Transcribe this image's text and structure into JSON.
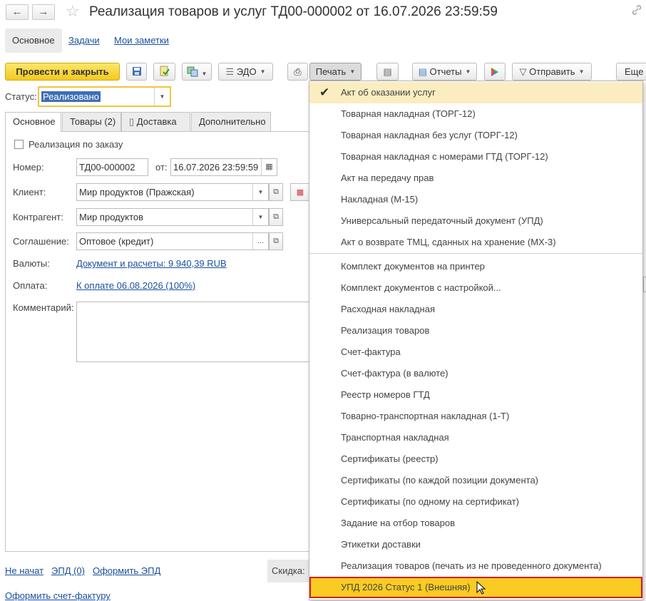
{
  "header": {
    "title": "Реализация товаров и услуг ТД00-000002 от 16.07.2026 23:59:59",
    "back_icon": "arrow-left",
    "forward_icon": "arrow-right",
    "star_icon": "star-outline",
    "link_icon": "link"
  },
  "top_tabs": [
    "Основное",
    "Задачи",
    "Мои заметки"
  ],
  "toolbar": {
    "post_close": "Провести и закрыть",
    "edo": "ЭДО",
    "print": "Печать",
    "reports": "Отчеты",
    "send": "Отправить",
    "more": "Еще"
  },
  "status": {
    "label": "Статус:",
    "value": "Реализовано"
  },
  "form_tabs": [
    "Основное",
    "Товары (2)",
    "Доставка",
    "Дополнительно"
  ],
  "form": {
    "by_order_label": "Реализация по заказу",
    "number_label": "Номер:",
    "number_value": "ТД00-000002",
    "date_label": "от:",
    "date_value": "16.07.2026 23:59:59",
    "client_label": "Клиент:",
    "client_value": "Мир продуктов (Пражская)",
    "counterparty_label": "Контрагент:",
    "counterparty_value": "Мир продуктов",
    "agreement_label": "Соглашение:",
    "agreement_value": "Оптовое (кредит)",
    "currency_label": "Валюты:",
    "currency_link": "Документ и расчеты: 9 940,39 RUB",
    "payment_label": "Оплата:",
    "payment_link": "К оплате 06.08.2026 (100%)",
    "comment_label": "Комментарий:"
  },
  "footer": {
    "not_started": "Не начат",
    "epd": "ЭПД (0)",
    "make_epd": "Оформить ЭПД",
    "discount_label": "Скидка:",
    "invoice_link": "Оформить счет-фактуру"
  },
  "print_menu": {
    "group1": [
      "Акт об оказании услуг",
      "Товарная накладная (ТОРГ-12)",
      "Товарная накладная без услуг (ТОРГ-12)",
      "Товарная накладная с номерами ГТД (ТОРГ-12)",
      "Акт на передачу прав",
      "Накладная (М-15)",
      "Универсальный передаточный документ (УПД)",
      "Акт о возврате ТМЦ, сданных на хранение (МХ-3)"
    ],
    "group2": [
      "Комплект документов на принтер",
      "Комплект документов с настройкой...",
      "Расходная накладная",
      "Реализация товаров",
      "Счет-фактура",
      "Счет-фактура (в валюте)",
      "Реестр номеров ГТД",
      "Товарно-транспортная накладная (1-Т)",
      "Транспортная накладная",
      "Сертификаты (реестр)",
      "Сертификаты (по каждой позиции документа)",
      "Сертификаты (по одному на сертификат)",
      "Задание на отбор товаров",
      "Этикетки доставки",
      "Реализация товаров (печать из не проведенного документа)",
      "УПД 2026 Статус 1 (Внешняя)"
    ],
    "checked_item": "Акт об оказании услуг",
    "highlighted_item": "УПД 2026 Статус 1 (Внешняя)"
  },
  "colors": {
    "primary_button": "#f5cf2a",
    "link": "#1a4f9c",
    "menu_highlight": "#f9cb23",
    "menu_highlight_border": "#d21f1f",
    "checked_bg": "#fbedc0"
  }
}
